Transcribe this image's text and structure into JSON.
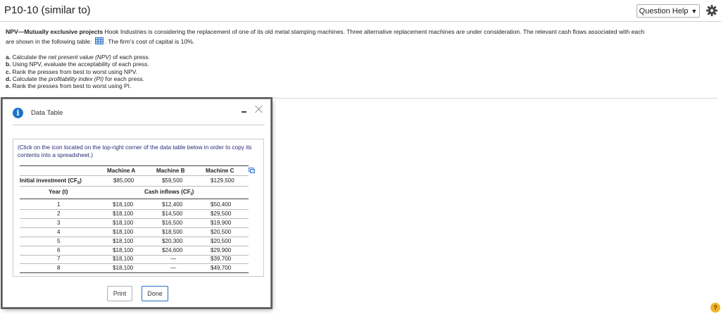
{
  "header": {
    "title": "P10-10 (similar to)",
    "question_help_label": "Question Help"
  },
  "problem": {
    "label": "NPV—Mutually exclusive projects",
    "text_line1": " Hook Industries is considering the replacement of one of its old metal stamping machines.  Three alternative replacement machines are under consideration.  The relevant cash flows associated with each",
    "text_line2a": "are shown in the following table: ",
    "text_line2b": ".  The firm's cost of capital is 10%.",
    "tasks": [
      {
        "letter": "a.",
        "pre": "Calculate the ",
        "em": "net present value (NPV)",
        "post": " of each press."
      },
      {
        "letter": "b.",
        "pre": "Using NPV, evaluate the acceptability of each press.",
        "em": "",
        "post": ""
      },
      {
        "letter": "c.",
        "pre": "Rank the presses from best to worst using NPV.",
        "em": "",
        "post": ""
      },
      {
        "letter": "d.",
        "pre": "Calculate the ",
        "em": "profitability index (PI)",
        "post": " for each press."
      },
      {
        "letter": "e.",
        "pre": "Rank the presses from best to worst using PI.",
        "em": "",
        "post": ""
      }
    ]
  },
  "modal": {
    "title": "Data Table",
    "instructions": "(Click on the icon located on the top-right corner of the data table below in order to copy its contents into a spreadsheet.)",
    "columns": [
      "Machine A",
      "Machine B",
      "Machine C"
    ],
    "initial_label": "Initial investment (CF",
    "initial_sub": "0",
    "initial_values": [
      "$85,000",
      "$59,500",
      "$129,500"
    ],
    "year_label": "Year (t)",
    "cash_label": "Cash inflows (CF",
    "cash_sub": "t",
    "rows": [
      {
        "year": "1",
        "a": "$18,100",
        "b": "$12,400",
        "c": "$50,400"
      },
      {
        "year": "2",
        "a": "$18,100",
        "b": "$14,500",
        "c": "$29,500"
      },
      {
        "year": "3",
        "a": "$18,100",
        "b": "$16,500",
        "c": "$19,900"
      },
      {
        "year": "4",
        "a": "$18,100",
        "b": "$18,500",
        "c": "$20,500"
      },
      {
        "year": "5",
        "a": "$18,100",
        "b": "$20,300",
        "c": "$20,500"
      },
      {
        "year": "6",
        "a": "$18,100",
        "b": "$24,600",
        "c": "$29,900"
      },
      {
        "year": "7",
        "a": "$18,100",
        "b": "—",
        "c": "$39,700"
      },
      {
        "year": "8",
        "a": "$18,100",
        "b": "—",
        "c": "$49,700"
      }
    ],
    "print_label": "Print",
    "done_label": "Done"
  },
  "help_badge": "?",
  "colors": {
    "info_blue": "#1a73c9",
    "done_border": "#2a6fc9",
    "help_yellow": "#f0b429"
  }
}
